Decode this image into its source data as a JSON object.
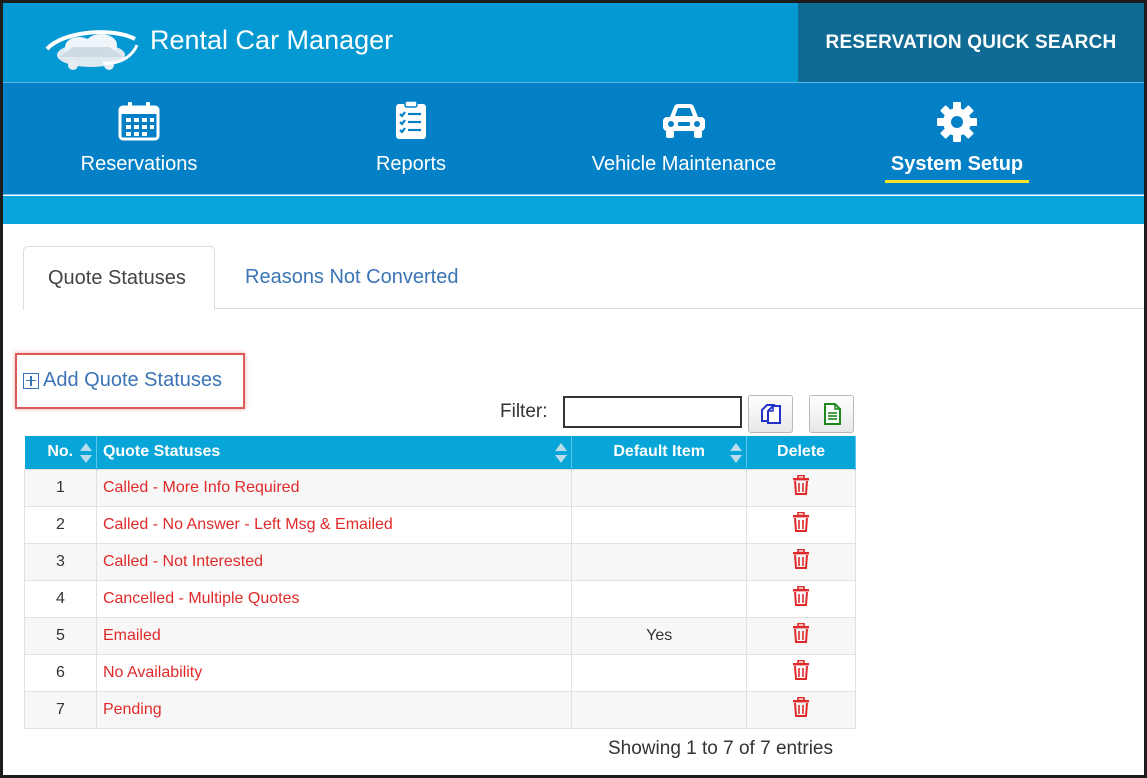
{
  "app": {
    "title": "Rental Car Manager",
    "quick_search": "RESERVATION QUICK SEARCH"
  },
  "nav": [
    {
      "label": "Reservations",
      "icon": "calendar-icon",
      "active": false
    },
    {
      "label": "Reports",
      "icon": "checklist-icon",
      "active": false
    },
    {
      "label": "Vehicle Maintenance",
      "icon": "car-icon",
      "active": false
    },
    {
      "label": "System Setup",
      "icon": "gear-icon",
      "active": true
    }
  ],
  "tabs": [
    {
      "label": "Quote Statuses",
      "active": true
    },
    {
      "label": "Reasons Not Converted",
      "active": false
    }
  ],
  "add_link": "Add Quote Statuses",
  "filter": {
    "label": "Filter:",
    "value": ""
  },
  "table": {
    "headers": {
      "no": "No.",
      "status": "Quote Statuses",
      "default": "Default Item",
      "delete": "Delete"
    },
    "rows": [
      {
        "no": "1",
        "status": "Called - More Info Required",
        "default": ""
      },
      {
        "no": "2",
        "status": "Called - No Answer - Left Msg & Emailed",
        "default": ""
      },
      {
        "no": "3",
        "status": "Called - Not Interested",
        "default": ""
      },
      {
        "no": "4",
        "status": "Cancelled - Multiple Quotes",
        "default": ""
      },
      {
        "no": "5",
        "status": "Emailed",
        "default": "Yes"
      },
      {
        "no": "6",
        "status": "No Availability",
        "default": ""
      },
      {
        "no": "7",
        "status": "Pending",
        "default": ""
      }
    ]
  },
  "footer": "Showing 1 to 7 of 7 entries",
  "colors": {
    "topbar": "#0499d2",
    "nav": "#0380c6",
    "quick_search": "#0f6b93",
    "accent_underline": "#f3e62a",
    "status_text": "#e02a2a",
    "link": "#3a74b4"
  }
}
